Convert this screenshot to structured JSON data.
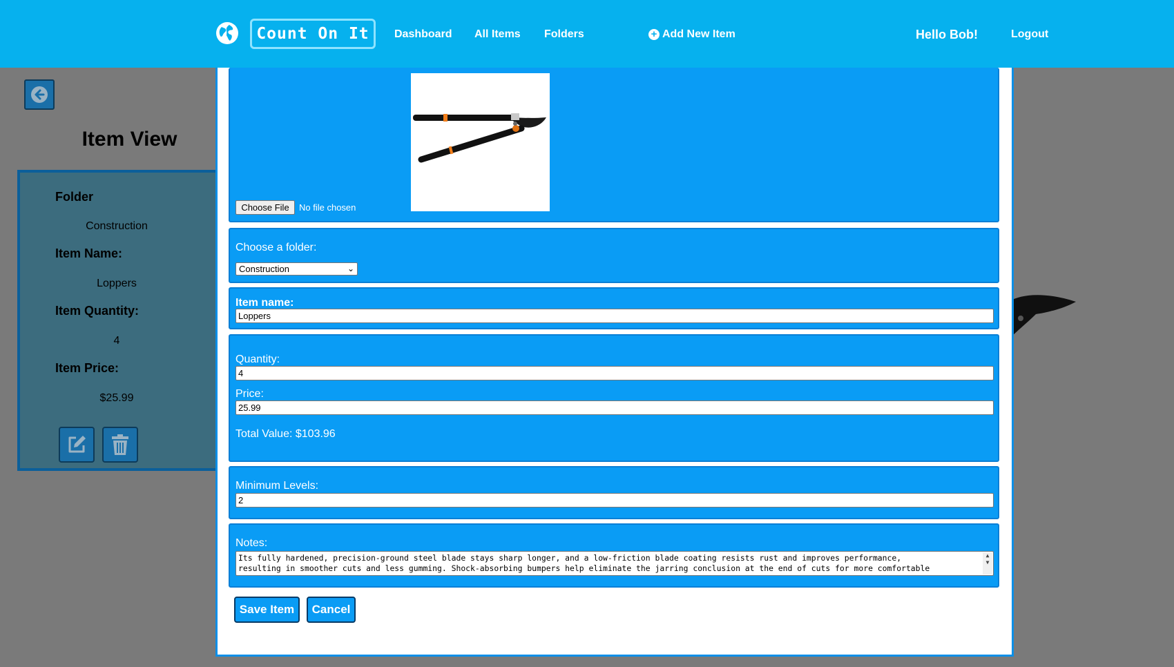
{
  "nav": {
    "brand": "Count On It",
    "links": [
      "Dashboard",
      "All Items",
      "Folders"
    ],
    "add_item": "Add New Item",
    "greeting": "Hello Bob!",
    "logout": "Logout"
  },
  "background_page": {
    "title": "Item View",
    "fields": [
      {
        "label": "Folder",
        "value": "Construction"
      },
      {
        "label": "Item Name:",
        "value": "Loppers"
      },
      {
        "label": "Item Quantity:",
        "value": "4"
      },
      {
        "label": "Item Price:",
        "value": "$25.99"
      }
    ]
  },
  "edit_form": {
    "file_button": "Choose File",
    "file_status": "No file chosen",
    "folder_label": "Choose a folder:",
    "folder_selected": "Construction",
    "name_label": "Item name:",
    "name_value": "Loppers",
    "quantity_label": "Quantity:",
    "quantity_value": "4",
    "price_label": "Price:",
    "price_value": "25.99",
    "total_value": "Total Value: $103.96",
    "min_label": "Minimum Levels:",
    "min_value": "2",
    "notes_label": "Notes:",
    "notes_lines": [
      "Its fully hardened, precision-ground steel blade stays sharp longer, and a low-friction blade coating resists rust and improves performance,",
      "resulting in smoother cuts and less gumming. Shock-absorbing bumpers help eliminate the jarring conclusion at the end of cuts for more comfortable"
    ],
    "save_label": "Save Item",
    "cancel_label": "Cancel"
  },
  "colors": {
    "navbar": "#06b1ee",
    "section": "#0a9cf5",
    "overlay": "#7a7a7a",
    "card": "#3c6c7e"
  },
  "icons": [
    "globe-icon",
    "plus-circle-icon",
    "arrow-left-circle-icon",
    "edit-icon",
    "trash-icon",
    "loppers-image"
  ]
}
